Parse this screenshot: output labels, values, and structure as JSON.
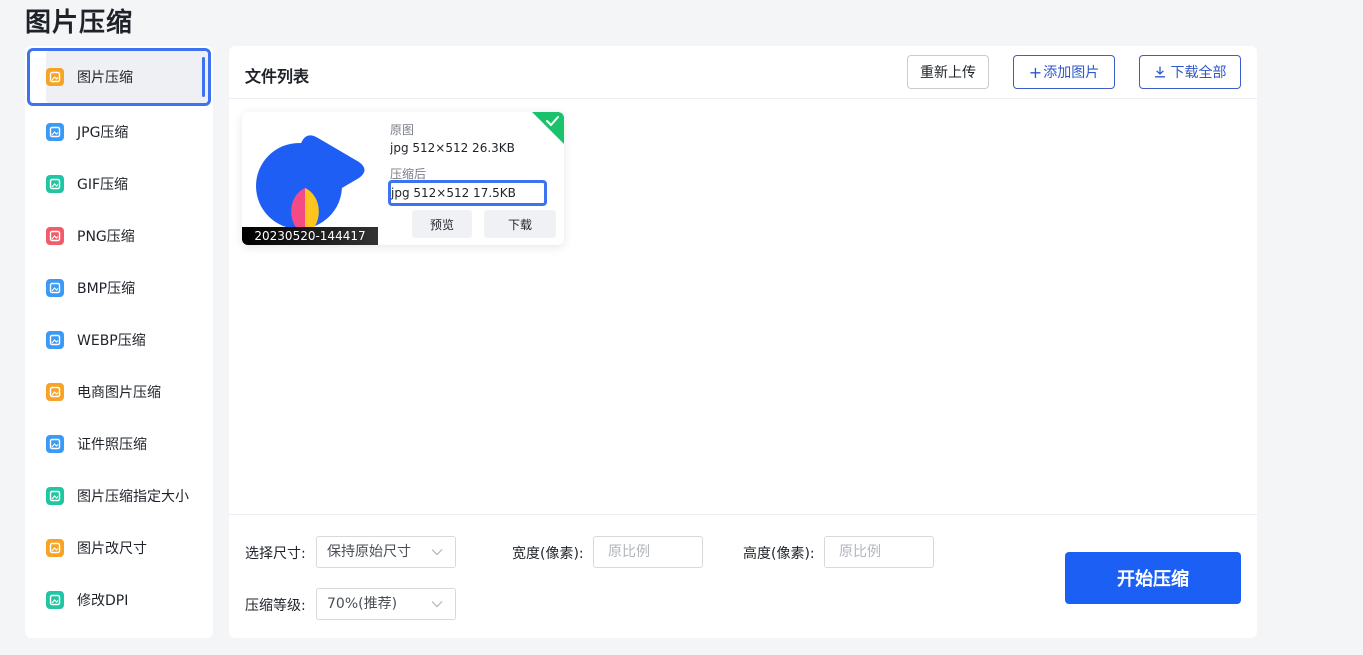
{
  "page": {
    "title": "图片压缩"
  },
  "sidebar": {
    "items": [
      {
        "label": "图片压缩",
        "icon": "image-compress-icon",
        "color": "#f7a325",
        "active": true
      },
      {
        "label": "JPG压缩",
        "icon": "jpg-compress-icon",
        "color": "#3b9af5",
        "active": false
      },
      {
        "label": "GIF压缩",
        "icon": "gif-compress-icon",
        "color": "#20c6a2",
        "active": false
      },
      {
        "label": "PNG压缩",
        "icon": "png-compress-icon",
        "color": "#f25c6a",
        "active": false
      },
      {
        "label": "BMP压缩",
        "icon": "bmp-compress-icon",
        "color": "#3b9af5",
        "active": false
      },
      {
        "label": "WEBP压缩",
        "icon": "webp-compress-icon",
        "color": "#3b9af5",
        "active": false
      },
      {
        "label": "电商图片压缩",
        "icon": "ecommerce-image-icon",
        "color": "#f7a325",
        "active": false
      },
      {
        "label": "证件照压缩",
        "icon": "id-photo-icon",
        "color": "#3b9af5",
        "active": false
      },
      {
        "label": "图片压缩指定大小",
        "icon": "size-target-icon",
        "color": "#20c6a2",
        "active": false
      },
      {
        "label": "图片改尺寸",
        "icon": "resize-icon",
        "color": "#f7a325",
        "active": false
      },
      {
        "label": "修改DPI",
        "icon": "dpi-icon",
        "color": "#20c6a2",
        "active": false
      }
    ]
  },
  "main": {
    "list_title": "文件列表",
    "reupload_label": "重新上传",
    "add_label": "添加图片",
    "download_all_label": "下载全部"
  },
  "file": {
    "name": "20230520-144417",
    "original_label": "原图",
    "original_info": "jpg  512×512  26.3KB",
    "compressed_label": "压缩后",
    "compressed_info": "jpg  512×512  17.5KB",
    "preview_label": "预览",
    "download_label": "下载",
    "status": "done"
  },
  "settings": {
    "size_label": "选择尺寸:",
    "size_value": "保持原始尺寸",
    "width_label": "宽度(像素):",
    "width_placeholder": "原比例",
    "height_label": "高度(像素):",
    "height_placeholder": "原比例",
    "quality_label": "压缩等级:",
    "quality_value": "70%(推荐)",
    "start_label": "开始压缩"
  },
  "colors": {
    "accent": "#1b5ff5",
    "success": "#19c26b",
    "active_border": "#3d72f0"
  }
}
